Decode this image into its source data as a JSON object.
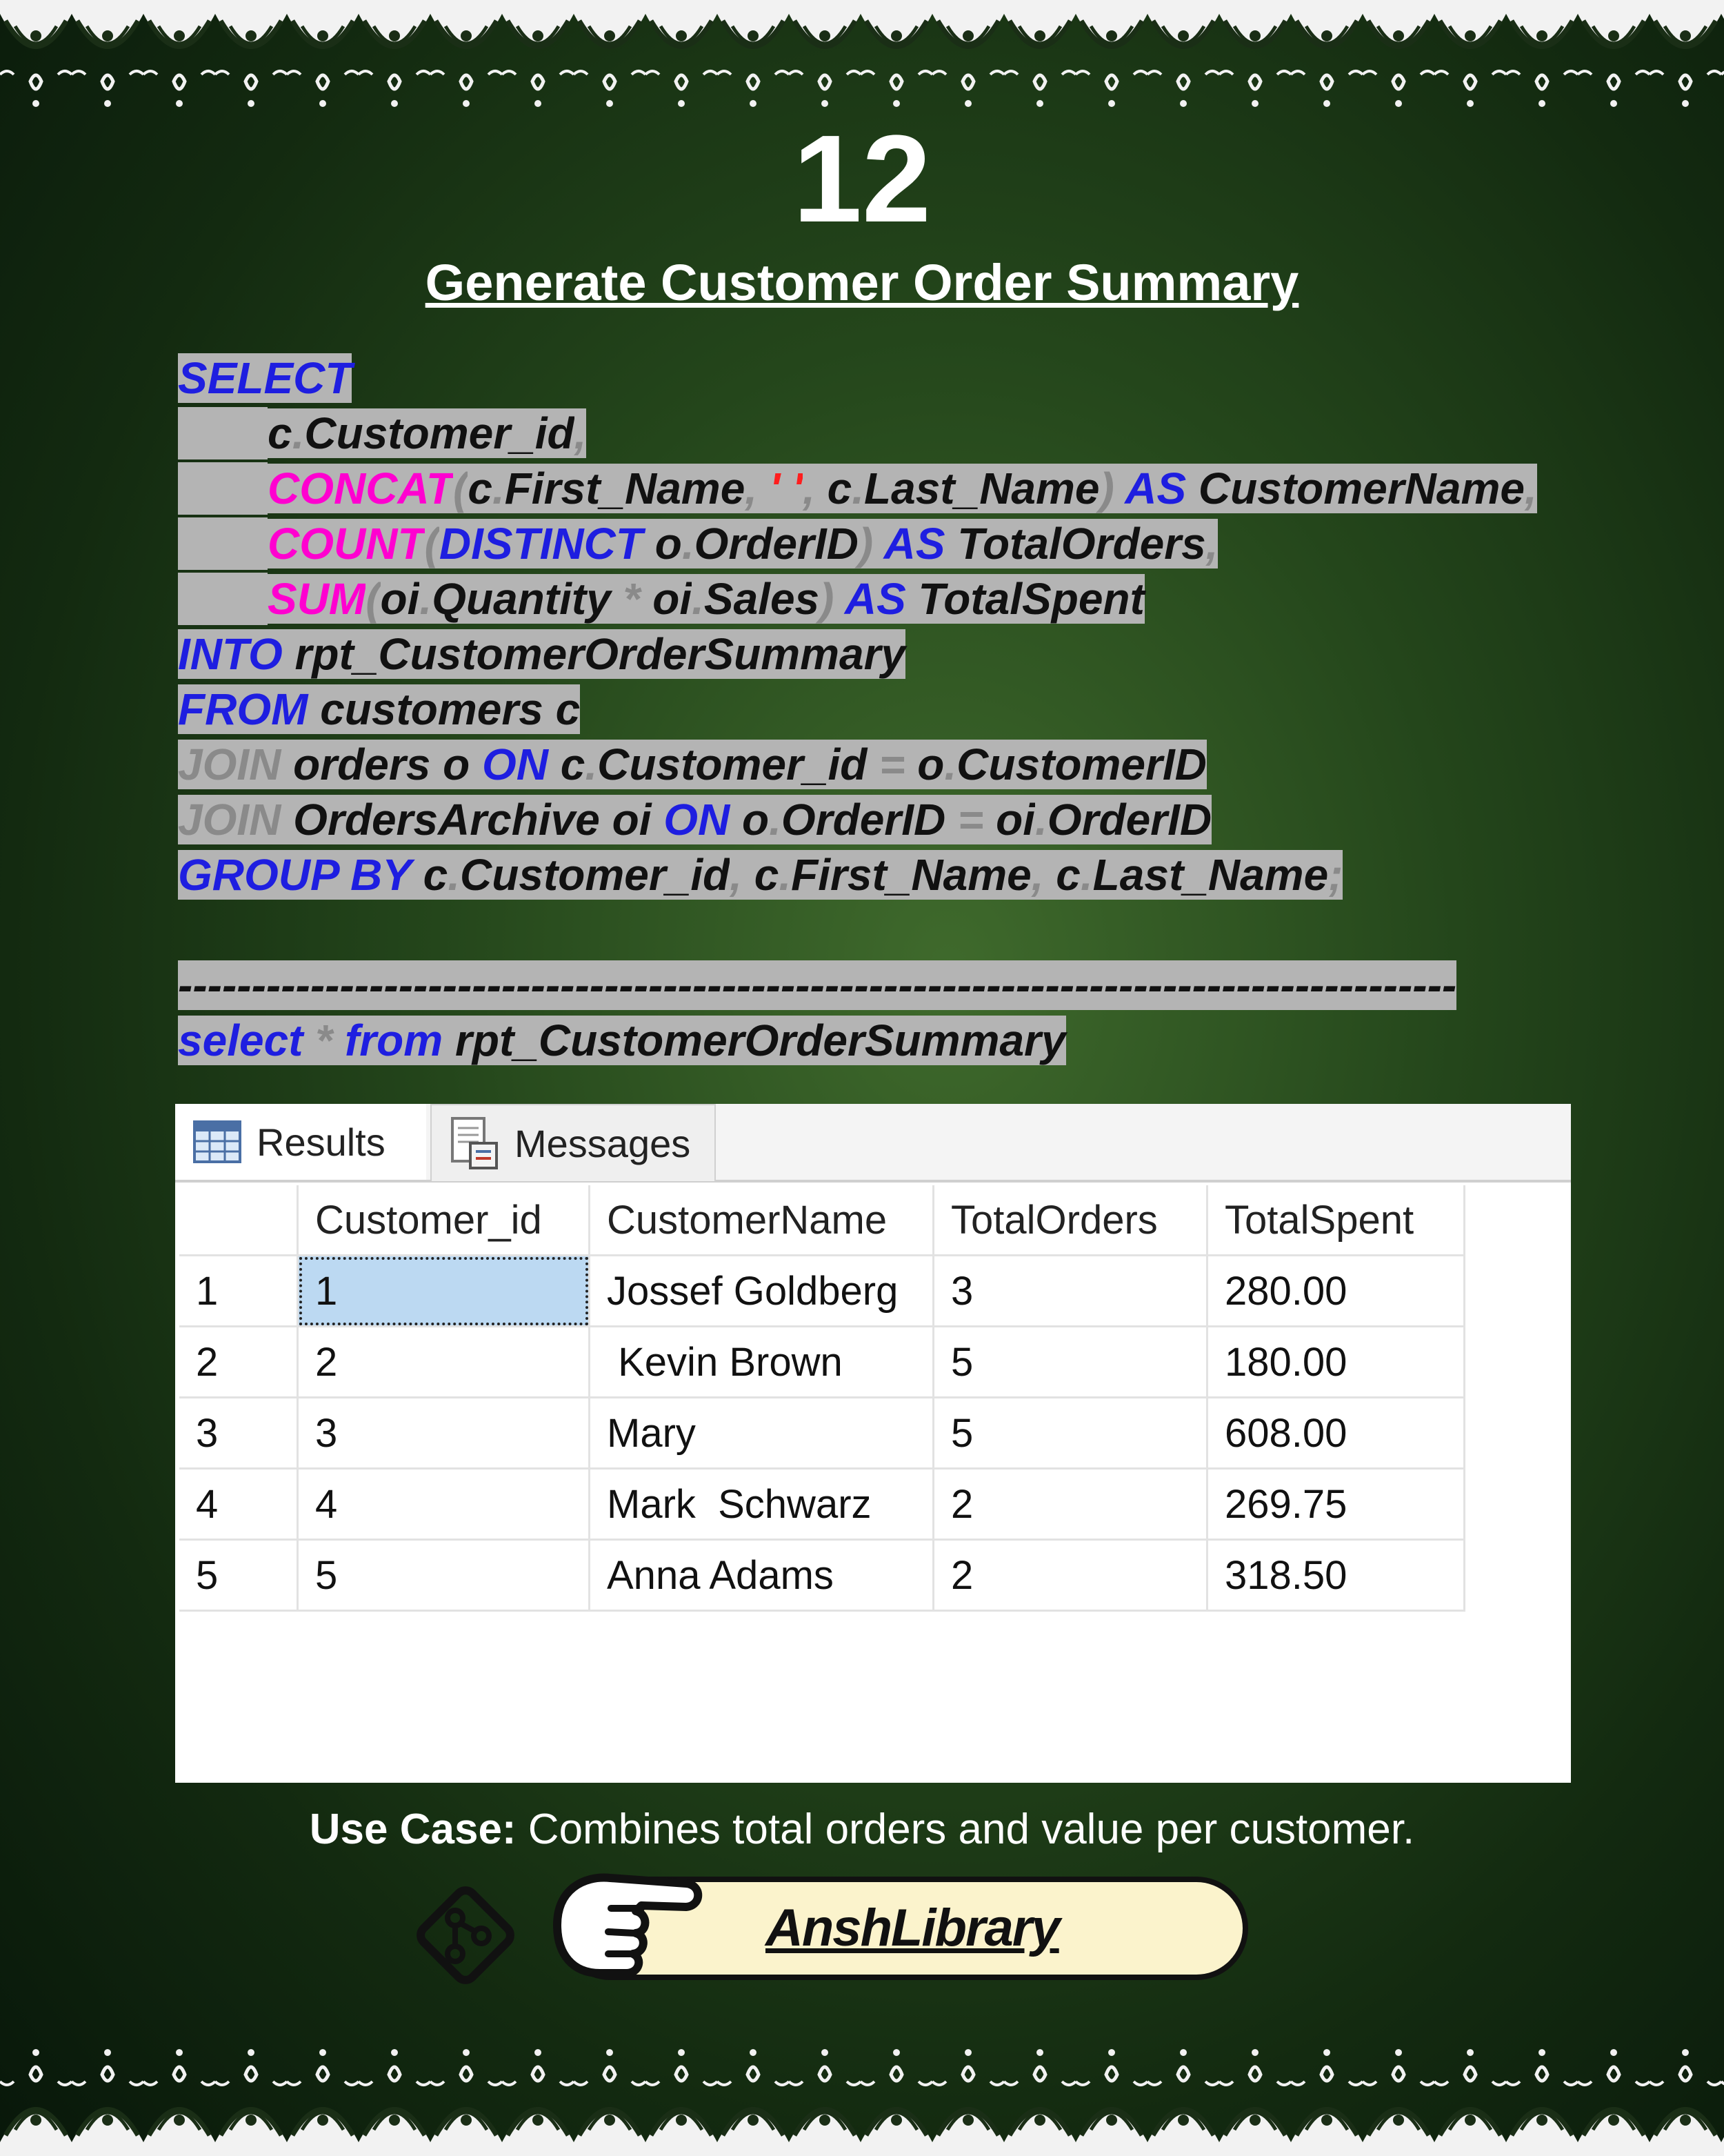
{
  "page_number": "12",
  "title": "Generate Customer Order Summary",
  "code_lines": [
    [
      {
        "t": "SELECT",
        "c": "kw"
      }
    ],
    [
      {
        "t": "c",
        "c": "tx"
      },
      {
        "t": ".",
        "c": "gr"
      },
      {
        "t": "Customer_id",
        "c": "tx"
      },
      {
        "t": ",",
        "c": "gr"
      }
    ],
    [
      {
        "t": "CONCAT",
        "c": "fn"
      },
      {
        "t": "(",
        "c": "gr"
      },
      {
        "t": "c",
        "c": "tx"
      },
      {
        "t": ".",
        "c": "gr"
      },
      {
        "t": "First_Name",
        "c": "tx"
      },
      {
        "t": ", ",
        "c": "gr"
      },
      {
        "t": "' '",
        "c": "st"
      },
      {
        "t": ", ",
        "c": "gr"
      },
      {
        "t": "c",
        "c": "tx"
      },
      {
        "t": ".",
        "c": "gr"
      },
      {
        "t": "Last_Name",
        "c": "tx"
      },
      {
        "t": ") ",
        "c": "gr"
      },
      {
        "t": "AS ",
        "c": "kw"
      },
      {
        "t": "CustomerName",
        "c": "tx"
      },
      {
        "t": ",",
        "c": "gr"
      }
    ],
    [
      {
        "t": "COUNT",
        "c": "fn"
      },
      {
        "t": "(",
        "c": "gr"
      },
      {
        "t": "DISTINCT ",
        "c": "kw"
      },
      {
        "t": "o",
        "c": "tx"
      },
      {
        "t": ".",
        "c": "gr"
      },
      {
        "t": "OrderID",
        "c": "tx"
      },
      {
        "t": ") ",
        "c": "gr"
      },
      {
        "t": "AS ",
        "c": "kw"
      },
      {
        "t": "TotalOrders",
        "c": "tx"
      },
      {
        "t": ",",
        "c": "gr"
      }
    ],
    [
      {
        "t": "SUM",
        "c": "fn"
      },
      {
        "t": "(",
        "c": "gr"
      },
      {
        "t": "oi",
        "c": "tx"
      },
      {
        "t": ".",
        "c": "gr"
      },
      {
        "t": "Quantity ",
        "c": "tx"
      },
      {
        "t": "* ",
        "c": "gr"
      },
      {
        "t": "oi",
        "c": "tx"
      },
      {
        "t": ".",
        "c": "gr"
      },
      {
        "t": "Sales",
        "c": "tx"
      },
      {
        "t": ") ",
        "c": "gr"
      },
      {
        "t": "AS ",
        "c": "kw"
      },
      {
        "t": "TotalSpent",
        "c": "tx"
      }
    ],
    [
      {
        "t": "INTO ",
        "c": "kw"
      },
      {
        "t": "rpt_CustomerOrderSummary",
        "c": "tx"
      }
    ],
    [
      {
        "t": "FROM ",
        "c": "kw"
      },
      {
        "t": "customers c",
        "c": "tx"
      }
    ],
    [
      {
        "t": "JOIN ",
        "c": "gr"
      },
      {
        "t": "orders o ",
        "c": "tx"
      },
      {
        "t": "ON ",
        "c": "kw"
      },
      {
        "t": "c",
        "c": "tx"
      },
      {
        "t": ".",
        "c": "gr"
      },
      {
        "t": "Customer_id ",
        "c": "tx"
      },
      {
        "t": "= ",
        "c": "gr"
      },
      {
        "t": "o",
        "c": "tx"
      },
      {
        "t": ".",
        "c": "gr"
      },
      {
        "t": "CustomerID",
        "c": "tx"
      }
    ],
    [
      {
        "t": "JOIN ",
        "c": "gr"
      },
      {
        "t": "OrdersArchive oi ",
        "c": "tx"
      },
      {
        "t": "ON ",
        "c": "kw"
      },
      {
        "t": "o",
        "c": "tx"
      },
      {
        "t": ".",
        "c": "gr"
      },
      {
        "t": "OrderID ",
        "c": "tx"
      },
      {
        "t": "= ",
        "c": "gr"
      },
      {
        "t": "oi",
        "c": "tx"
      },
      {
        "t": ".",
        "c": "gr"
      },
      {
        "t": "OrderID",
        "c": "tx"
      }
    ],
    [
      {
        "t": "GROUP BY ",
        "c": "kw"
      },
      {
        "t": "c",
        "c": "tx"
      },
      {
        "t": ".",
        "c": "gr"
      },
      {
        "t": "Customer_id",
        "c": "tx"
      },
      {
        "t": ", ",
        "c": "gr"
      },
      {
        "t": "c",
        "c": "tx"
      },
      {
        "t": ".",
        "c": "gr"
      },
      {
        "t": "First_Name",
        "c": "tx"
      },
      {
        "t": ", ",
        "c": "gr"
      },
      {
        "t": "c",
        "c": "tx"
      },
      {
        "t": ".",
        "c": "gr"
      },
      {
        "t": "Last_Name",
        "c": "tx"
      },
      {
        "t": ";",
        "c": "gr"
      }
    ],
    [
      {
        "t": "---------------------------------------------------------------------------------------",
        "c": "tx"
      }
    ],
    [
      {
        "t": "select ",
        "c": "kw"
      },
      {
        "t": "* ",
        "c": "gr"
      },
      {
        "t": "from ",
        "c": "kw"
      },
      {
        "t": "rpt_CustomerOrderSummary",
        "c": "tx"
      }
    ]
  ],
  "code_indent": [
    false,
    true,
    true,
    true,
    true,
    false,
    false,
    false,
    false,
    false,
    false,
    false
  ],
  "results_panel": {
    "tabs": [
      {
        "label": "Results",
        "icon": "grid-icon"
      },
      {
        "label": "Messages",
        "icon": "messages-icon"
      }
    ],
    "columns": [
      "",
      "Customer_id",
      "CustomerName",
      "TotalOrders",
      "TotalSpent"
    ],
    "rows": [
      [
        "1",
        "1",
        "Jossef Goldberg",
        "3",
        "280.00"
      ],
      [
        "2",
        "2",
        " Kevin Brown",
        "5",
        "180.00"
      ],
      [
        "3",
        "3",
        "Mary",
        "5",
        "608.00"
      ],
      [
        "4",
        "4",
        "Mark  Schwarz",
        "2",
        "269.75"
      ],
      [
        "5",
        "5",
        "Anna Adams",
        "2",
        "318.50"
      ]
    ],
    "selected_cell": {
      "row": 0,
      "col": 1
    },
    "selection_color": "#bcd9f2"
  },
  "use_case": {
    "label": "Use Case:",
    "text": " Combines total orders and value per customer."
  },
  "footer": {
    "brand": "AnshLibrary",
    "icons": [
      "git-icon",
      "pointing-hand-icon"
    ],
    "pill_color": "#fbf3cc"
  },
  "colors": {
    "keyword": "#1e1ee0",
    "function": "#ff00d0",
    "operator": "#8a8a8a",
    "string": "#ff1e1e",
    "code_highlight": "#b4b4b4",
    "background": "#1e3a17"
  }
}
